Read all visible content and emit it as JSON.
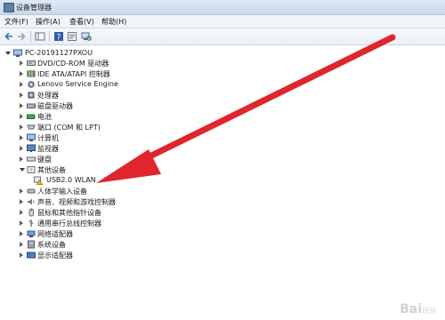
{
  "window": {
    "title": "设备管理器"
  },
  "menu": [
    "文件(F)",
    "操作(A)",
    "查看(V)",
    "帮助(H)"
  ],
  "tree": {
    "root": "PC-20191127PXOU",
    "categories": [
      {
        "label": "DVD/CD-ROM 驱动器",
        "icon": "dvd-drive-icon"
      },
      {
        "label": "IDE ATA/ATAPI 控制器",
        "icon": "ide-controller-icon"
      },
      {
        "label": "Lenovo Service Engine",
        "icon": "gear-icon"
      },
      {
        "label": "处理器",
        "icon": "processor-icon"
      },
      {
        "label": "磁盘驱动器",
        "icon": "disk-drive-icon"
      },
      {
        "label": "电池",
        "icon": "battery-icon"
      },
      {
        "label": "端口 (COM 和 LPT)",
        "icon": "port-icon"
      },
      {
        "label": "计算机",
        "icon": "computer-icon"
      },
      {
        "label": "监视器",
        "icon": "monitor-icon"
      },
      {
        "label": "键盘",
        "icon": "keyboard-icon"
      },
      {
        "label": "其他设备",
        "icon": "other-devices-icon",
        "expanded": true,
        "children": [
          {
            "label": "USB2.0 WLAN",
            "icon": "warning-device-icon"
          }
        ]
      },
      {
        "label": "人体学输入设备",
        "icon": "hid-icon"
      },
      {
        "label": "声音、视频和游戏控制器",
        "icon": "sound-icon"
      },
      {
        "label": "鼠标和其他指针设备",
        "icon": "mouse-icon"
      },
      {
        "label": "通用串行总线控制器",
        "icon": "usb-icon"
      },
      {
        "label": "网络适配器",
        "icon": "network-adapter-icon"
      },
      {
        "label": "系统设备",
        "icon": "system-device-icon"
      },
      {
        "label": "显示适配器",
        "icon": "display-adapter-icon"
      }
    ]
  },
  "watermark": {
    "brand": "Bai",
    "suffix": "经验"
  },
  "colors": {
    "arrow": "#e0252b",
    "titlebar": "#c9d9ec",
    "warning": "#f2c200"
  }
}
